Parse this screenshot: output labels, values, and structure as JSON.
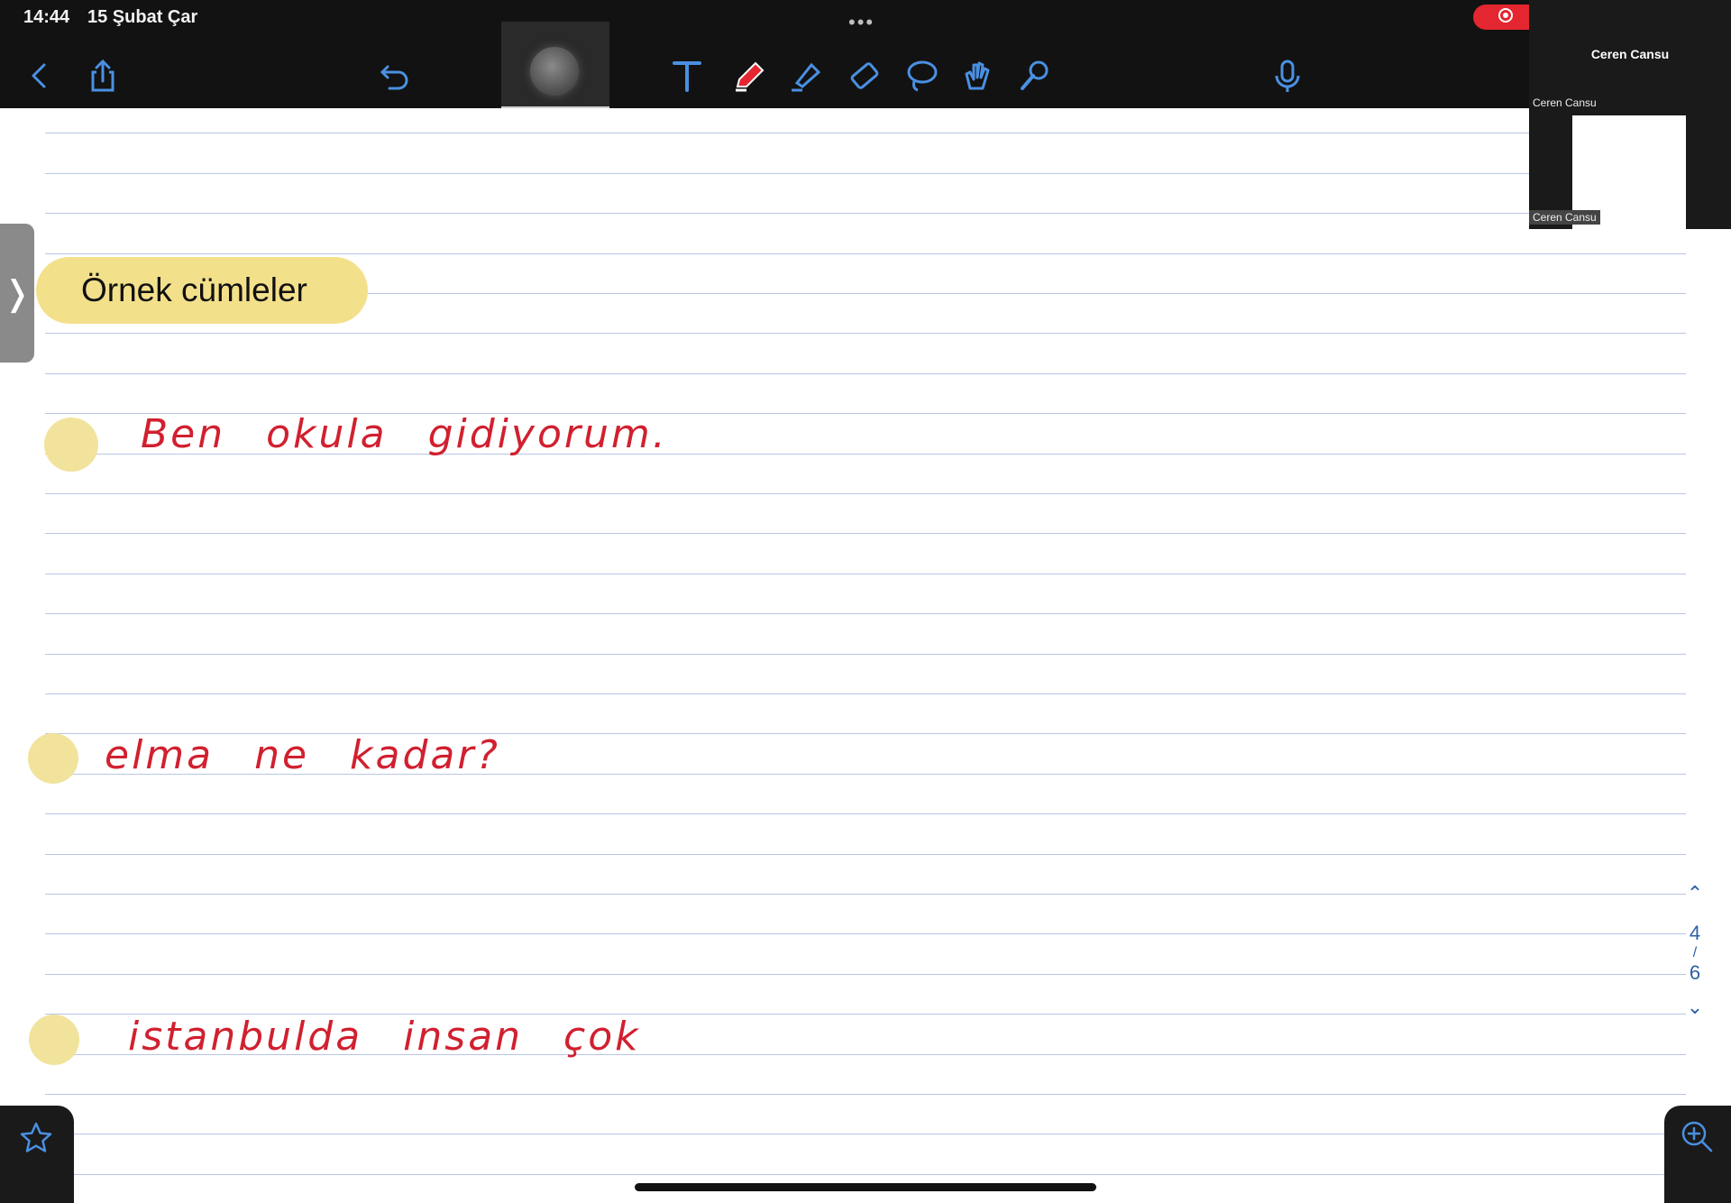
{
  "status_bar": {
    "time": "14:44",
    "date": "15 Şubat Çar",
    "dots": "•••"
  },
  "toolbar": {
    "icons": [
      "back-icon",
      "share-icon",
      "undo-icon",
      "text-tool-icon",
      "pen-tool-icon",
      "highlighter-tool-icon",
      "eraser-tool-icon",
      "lasso-tool-icon",
      "hand-tool-icon",
      "laser-pointer-icon",
      "microphone-icon"
    ],
    "pen_color": "#e3262f",
    "accent": "#3b82f6"
  },
  "participants": {
    "main_name": "Ceren Cansu",
    "label_1": "Ceren Cansu",
    "label_2": "Ceren Cansu"
  },
  "note": {
    "heading": "Örnek cümleler",
    "lines": [
      "Ben okula gidiyorum.",
      "elma ne kadar?",
      "istanbulda insan çok"
    ],
    "ink_color": "#d1202f",
    "highlight_color": "#f3e08a"
  },
  "pager": {
    "current": "4",
    "separator": "/",
    "total": "6"
  }
}
